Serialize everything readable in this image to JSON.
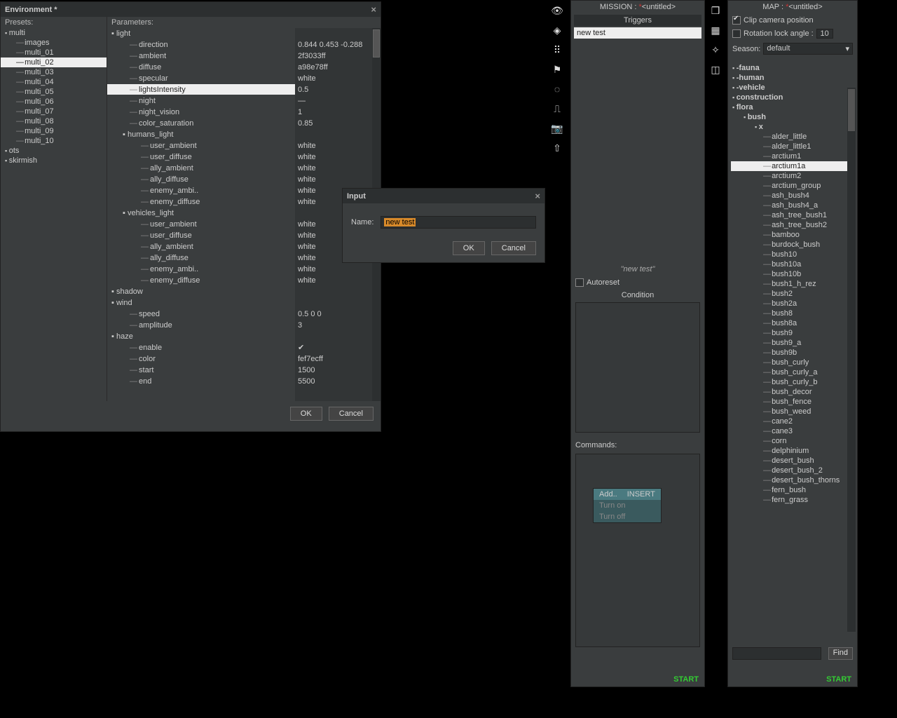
{
  "env": {
    "title": "Environment *",
    "presetsLabel": "Presets:",
    "paramsLabel": "Parameters:",
    "ok": "OK",
    "cancel": "Cancel",
    "presets": [
      {
        "label": "multi",
        "depth": 0,
        "folder": true
      },
      {
        "label": "images",
        "depth": 1
      },
      {
        "label": "multi_01",
        "depth": 1
      },
      {
        "label": "multi_02",
        "depth": 1,
        "selected": true
      },
      {
        "label": "multi_03",
        "depth": 1
      },
      {
        "label": "multi_04",
        "depth": 1
      },
      {
        "label": "multi_05",
        "depth": 1
      },
      {
        "label": "multi_06",
        "depth": 1
      },
      {
        "label": "multi_07",
        "depth": 1
      },
      {
        "label": "multi_08",
        "depth": 1
      },
      {
        "label": "multi_09",
        "depth": 1
      },
      {
        "label": "multi_10",
        "depth": 1
      },
      {
        "label": "ots",
        "depth": 0,
        "folder": true
      },
      {
        "label": "skirmish",
        "depth": 0,
        "folder": true
      }
    ],
    "params": [
      {
        "name": "light",
        "depth": 0,
        "folder": true,
        "val": ""
      },
      {
        "name": "direction",
        "depth": 1,
        "val": "0.844 0.453 -0.288"
      },
      {
        "name": "ambient",
        "depth": 1,
        "val": "2f3033ff"
      },
      {
        "name": "diffuse",
        "depth": 1,
        "val": "a98e78ff"
      },
      {
        "name": "specular",
        "depth": 1,
        "val": "white"
      },
      {
        "name": "lightsIntensity",
        "depth": 1,
        "val": "0.5",
        "selected": true
      },
      {
        "name": "night",
        "depth": 1,
        "val": "—"
      },
      {
        "name": "night_vision",
        "depth": 1,
        "val": "1"
      },
      {
        "name": "color_saturation",
        "depth": 1,
        "val": "0.85"
      },
      {
        "name": "humans_light",
        "depth": 1,
        "folder": true,
        "val": ""
      },
      {
        "name": "user_ambient",
        "depth": 2,
        "val": "white"
      },
      {
        "name": "user_diffuse",
        "depth": 2,
        "val": "white"
      },
      {
        "name": "ally_ambient",
        "depth": 2,
        "val": "white"
      },
      {
        "name": "ally_diffuse",
        "depth": 2,
        "val": "white"
      },
      {
        "name": "enemy_ambi..",
        "depth": 2,
        "val": "white"
      },
      {
        "name": "enemy_diffuse",
        "depth": 2,
        "val": "white"
      },
      {
        "name": "vehicles_light",
        "depth": 1,
        "folder": true,
        "val": ""
      },
      {
        "name": "user_ambient",
        "depth": 2,
        "val": "white"
      },
      {
        "name": "user_diffuse",
        "depth": 2,
        "val": "white"
      },
      {
        "name": "ally_ambient",
        "depth": 2,
        "val": "white"
      },
      {
        "name": "ally_diffuse",
        "depth": 2,
        "val": "white"
      },
      {
        "name": "enemy_ambi..",
        "depth": 2,
        "val": "white"
      },
      {
        "name": "enemy_diffuse",
        "depth": 2,
        "val": "white"
      },
      {
        "name": "shadow",
        "depth": 0,
        "folder": true,
        "val": ""
      },
      {
        "name": "wind",
        "depth": 0,
        "folder": true,
        "val": ""
      },
      {
        "name": "speed",
        "depth": 1,
        "val": "0.5 0 0"
      },
      {
        "name": "amplitude",
        "depth": 1,
        "val": "3"
      },
      {
        "name": "haze",
        "depth": 0,
        "folder": true,
        "val": ""
      },
      {
        "name": "enable",
        "depth": 1,
        "val": "✔"
      },
      {
        "name": "color",
        "depth": 1,
        "val": "fef7ecff"
      },
      {
        "name": "start",
        "depth": 1,
        "val": "1500"
      },
      {
        "name": "end",
        "depth": 1,
        "val": "5500"
      }
    ]
  },
  "inputDlg": {
    "title": "Input",
    "nameLabel": "Name:",
    "value": "new test",
    "ok": "OK",
    "cancel": "Cancel"
  },
  "iconbar": [
    "eye-icon",
    "diamond-icon",
    "grid-dots-icon",
    "flag-icon",
    "circle-dots-icon",
    "path-icon",
    "camera-icon",
    "arrow-icon"
  ],
  "mission": {
    "title": "MISSION : ",
    "untitled": "<untitled>",
    "triggersHdr": "Triggers",
    "triggers": [
      "new test"
    ],
    "current": "\"new test\"",
    "autoreset": "Autoreset",
    "conditionHdr": "Condition",
    "commandsHdr": "Commands:",
    "ctx": {
      "add": "Add..",
      "insert": "INSERT",
      "on": "Turn on",
      "off": "Turn off"
    },
    "start": "START"
  },
  "mapbar": [
    "cube-icon",
    "grid-icon",
    "wand-icon",
    "box-icon"
  ],
  "map": {
    "title": "MAP : ",
    "untitled": "<untitled>",
    "clipCam": "Clip camera position",
    "rotLock": "Rotation lock angle :",
    "rotVal": "10",
    "seasonLbl": "Season:",
    "seasonVal": "default",
    "find": "Find",
    "start": "START",
    "tree": [
      {
        "label": "-fauna",
        "cls": "mf0 mfold"
      },
      {
        "label": "-human",
        "cls": "mf0 mfold"
      },
      {
        "label": "-vehicle",
        "cls": "mf0 mfold"
      },
      {
        "label": "construction",
        "cls": "mf0 mfold"
      },
      {
        "label": "flora",
        "cls": "mf0 mfold"
      },
      {
        "label": "bush",
        "cls": "mf1 mfold"
      },
      {
        "label": "x",
        "cls": "mf2 mfold"
      },
      {
        "label": "alder_little",
        "cls": "ml3"
      },
      {
        "label": "alder_little1",
        "cls": "ml3"
      },
      {
        "label": "arctium1",
        "cls": "ml3"
      },
      {
        "label": "arctium1a",
        "cls": "ml3",
        "selected": true
      },
      {
        "label": "arctium2",
        "cls": "ml3"
      },
      {
        "label": "arctium_group",
        "cls": "ml3"
      },
      {
        "label": "ash_bush4",
        "cls": "ml3"
      },
      {
        "label": "ash_bush4_a",
        "cls": "ml3"
      },
      {
        "label": "ash_tree_bush1",
        "cls": "ml3"
      },
      {
        "label": "ash_tree_bush2",
        "cls": "ml3"
      },
      {
        "label": "bamboo",
        "cls": "ml3"
      },
      {
        "label": "burdock_bush",
        "cls": "ml3"
      },
      {
        "label": "bush10",
        "cls": "ml3"
      },
      {
        "label": "bush10a",
        "cls": "ml3"
      },
      {
        "label": "bush10b",
        "cls": "ml3"
      },
      {
        "label": "bush1_h_rez",
        "cls": "ml3"
      },
      {
        "label": "bush2",
        "cls": "ml3"
      },
      {
        "label": "bush2a",
        "cls": "ml3"
      },
      {
        "label": "bush8",
        "cls": "ml3"
      },
      {
        "label": "bush8a",
        "cls": "ml3"
      },
      {
        "label": "bush9",
        "cls": "ml3"
      },
      {
        "label": "bush9_a",
        "cls": "ml3"
      },
      {
        "label": "bush9b",
        "cls": "ml3"
      },
      {
        "label": "bush_curly",
        "cls": "ml3"
      },
      {
        "label": "bush_curly_a",
        "cls": "ml3"
      },
      {
        "label": "bush_curly_b",
        "cls": "ml3"
      },
      {
        "label": "bush_decor",
        "cls": "ml3"
      },
      {
        "label": "bush_fence",
        "cls": "ml3"
      },
      {
        "label": "bush_weed",
        "cls": "ml3"
      },
      {
        "label": "cane2",
        "cls": "ml3"
      },
      {
        "label": "cane3",
        "cls": "ml3"
      },
      {
        "label": "corn",
        "cls": "ml3"
      },
      {
        "label": "delphinium",
        "cls": "ml3"
      },
      {
        "label": "desert_bush",
        "cls": "ml3"
      },
      {
        "label": "desert_bush_2",
        "cls": "ml3"
      },
      {
        "label": "desert_bush_thorns",
        "cls": "ml3"
      },
      {
        "label": "fern_bush",
        "cls": "ml3"
      },
      {
        "label": "fern_grass",
        "cls": "ml3"
      }
    ]
  }
}
